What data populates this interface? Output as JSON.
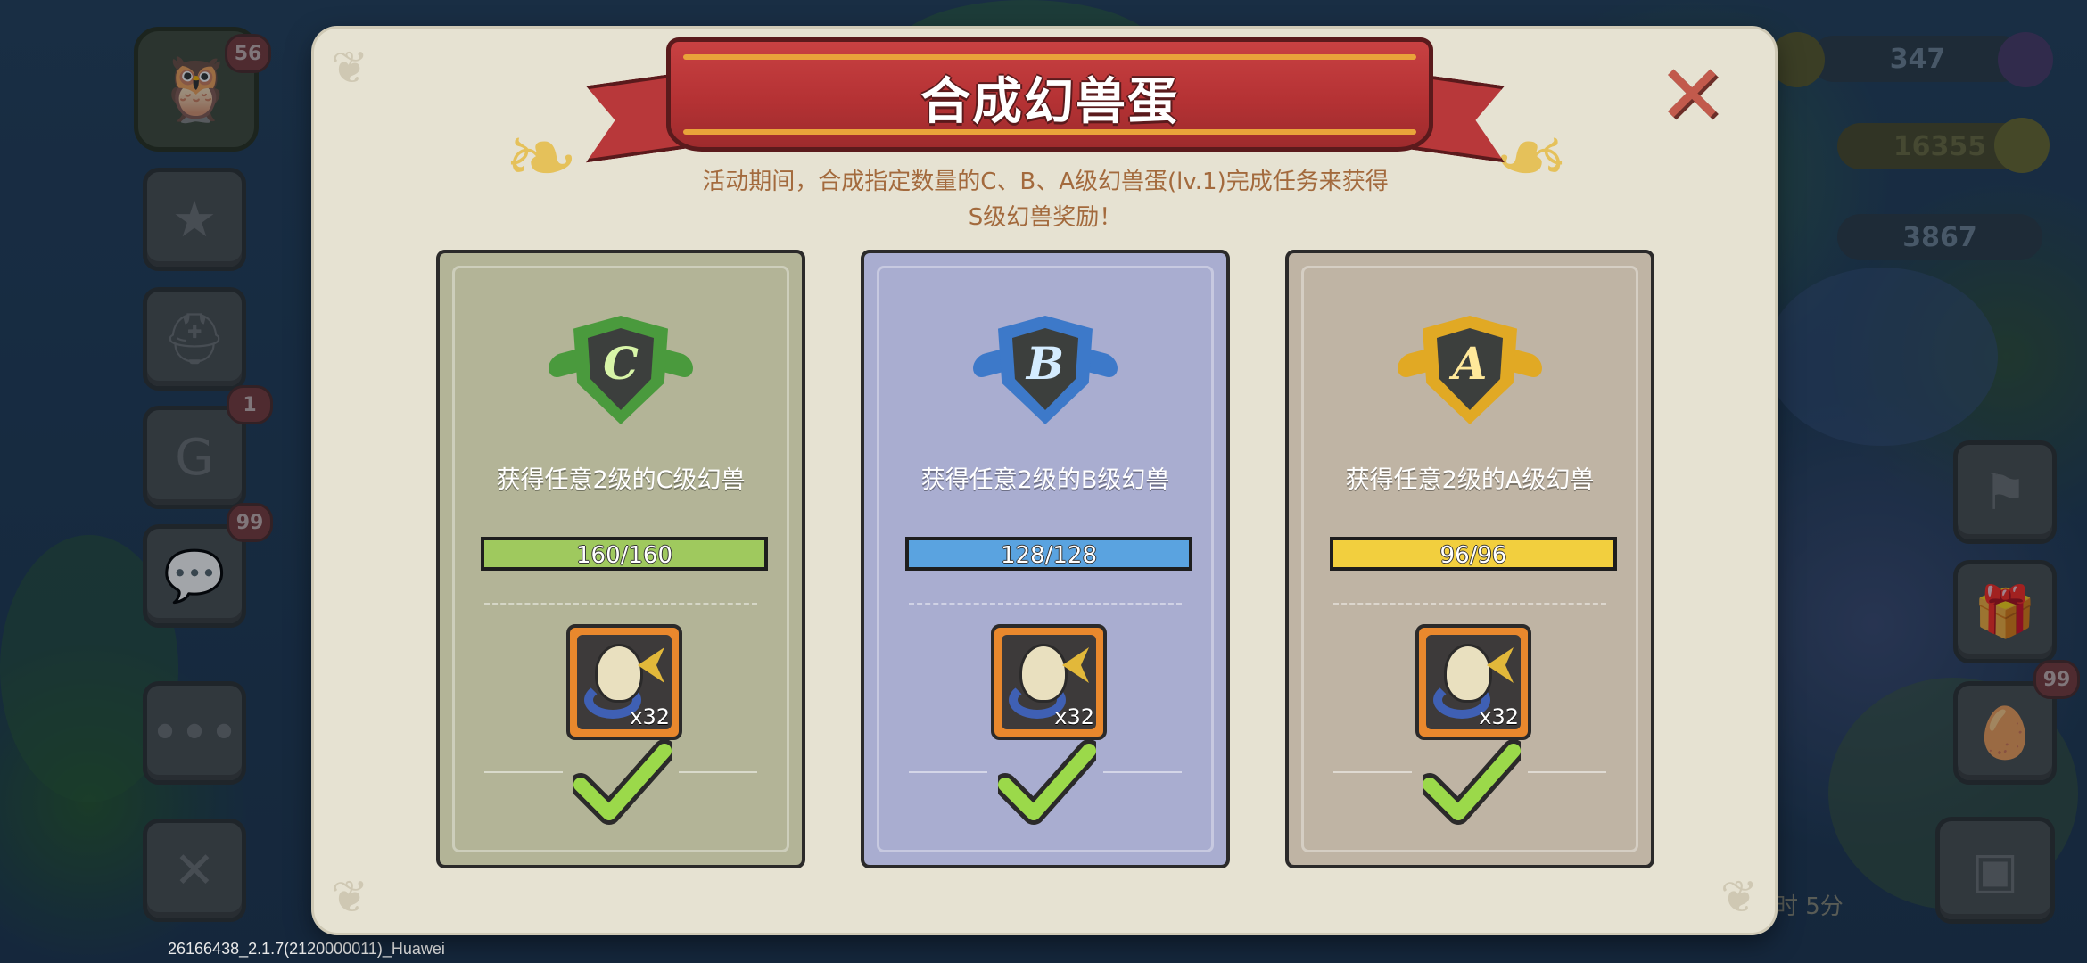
{
  "version_text": "26166438_2.1.7(2120000011)_Huawei",
  "background": {
    "owl_level": "56",
    "resources": [
      "347",
      "16355",
      "3867"
    ],
    "badges": {
      "book": "1",
      "chat": "99",
      "egg": "99"
    },
    "timer_fragment": "时 5分"
  },
  "dialog": {
    "title": "合成幻兽蛋",
    "description_line1": "活动期间，合成指定数量的C、B、A级幻兽蛋(lv.1)完成任务来获得",
    "description_line2": "S级幻兽奖励！",
    "close_icon": "close-x-icon",
    "colors": {
      "ribbon": "#b8383a",
      "card_c": "#b3b497",
      "card_b": "#a9add0",
      "card_a": "#bfb4a4"
    }
  },
  "cards": [
    {
      "grade": "C",
      "task": "获得任意2级的C级幻兽",
      "progress_text": "160/160",
      "progress_fraction": 1.0,
      "bar_color": "#9fc95e",
      "shield_color": "#4a9a3d",
      "letter_color": "#d8f5a8",
      "reward_qty": "x32",
      "completed": true
    },
    {
      "grade": "B",
      "task": "获得任意2级的B级幻兽",
      "progress_text": "128/128",
      "progress_fraction": 1.0,
      "bar_color": "#5aa3e0",
      "shield_color": "#3d79c9",
      "letter_color": "#d4ecff",
      "reward_qty": "x32",
      "completed": true
    },
    {
      "grade": "A",
      "task": "获得任意2级的A级幻兽",
      "progress_text": "96/96",
      "progress_fraction": 1.0,
      "bar_color": "#f2cf3e",
      "shield_color": "#e1a924",
      "letter_color": "#ffe89a",
      "reward_qty": "x32",
      "completed": true
    }
  ]
}
